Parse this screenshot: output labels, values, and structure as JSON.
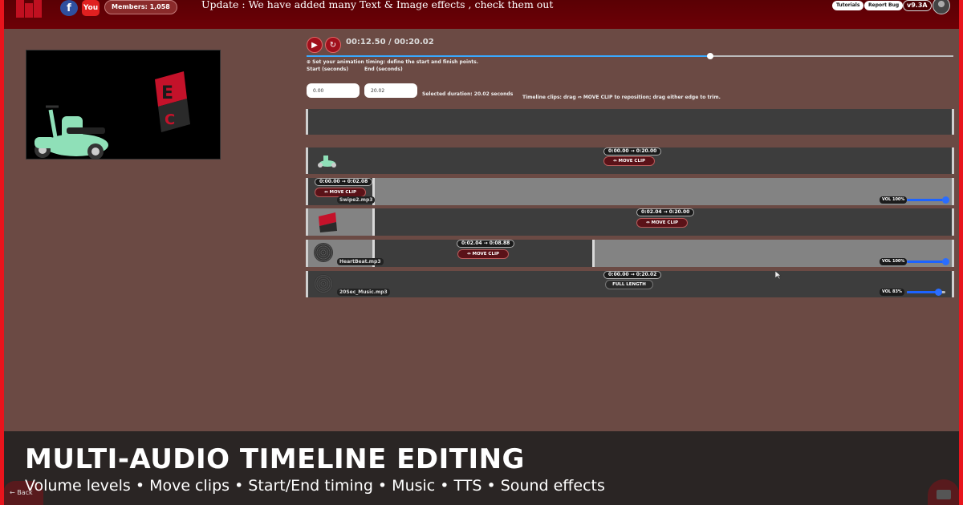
{
  "header": {
    "members": "Members: 1,058",
    "update": "Update : We have added many Text & Image effects , check them out",
    "tutorials": "Tutorials",
    "report_bug": "Report Bug",
    "version": "v9.3A",
    "fb_icon": "f",
    "yt_icon": "You"
  },
  "player": {
    "time": "00:12.50 / 00:20.02",
    "progress": 0.6244,
    "play_icon": "play-icon",
    "replay_icon": "replay-icon"
  },
  "timing": {
    "hint": "⊕ Set your animation timing: define the start and finish points.",
    "start_label": "Start (seconds)",
    "end_label": "End (seconds)",
    "start_value": "0.00",
    "end_value": "20.02",
    "selected": "Selected duration: 20.02 seconds",
    "clips_hint": "Timeline clips: drag ⇔ MOVE CLIP to reposition; drag either edge to trim."
  },
  "tracks": [
    {
      "range": "0:00.00 → 0:20.00",
      "button": "⇔ MOVE CLIP",
      "start": 0,
      "end": 20.0
    },
    {
      "range": "0:00.00 → 0:02.08",
      "button": "⇔ MOVE CLIP",
      "file": "Swipe2.mp3",
      "vol": "VOL 100%",
      "volume": 1.0,
      "start": 0,
      "end": 2.08
    },
    {
      "range": "0:02.04 → 0:20.00",
      "button": "⇔ MOVE CLIP",
      "start": 2.04,
      "end": 20.0
    },
    {
      "range": "0:02.04 → 0:08.88",
      "button": "⇔ MOVE CLIP",
      "file": "HeartBeat.mp3",
      "vol": "VOL 100%",
      "volume": 1.0,
      "start": 2.04,
      "end": 8.88
    },
    {
      "range": "0:00.00 → 0:20.02",
      "button": "FULL LENGTH",
      "file": "20Sec_Music.mp3",
      "vol": "VOL 83%",
      "volume": 0.83,
      "start": 0,
      "end": 20.02
    }
  ],
  "caption": {
    "title": "MULTI-AUDIO TIMELINE EDITING",
    "subtitle": "Volume levels • Move clips • Start/End timing • Music • TTS • Sound effects"
  },
  "footer": {
    "back": "← Back",
    "chat_icon": "chat-icon"
  },
  "colors": {
    "accent": "#a0101c",
    "background": "#6b4a44",
    "topbar": "#6d0006",
    "volume": "#1d63ff"
  }
}
